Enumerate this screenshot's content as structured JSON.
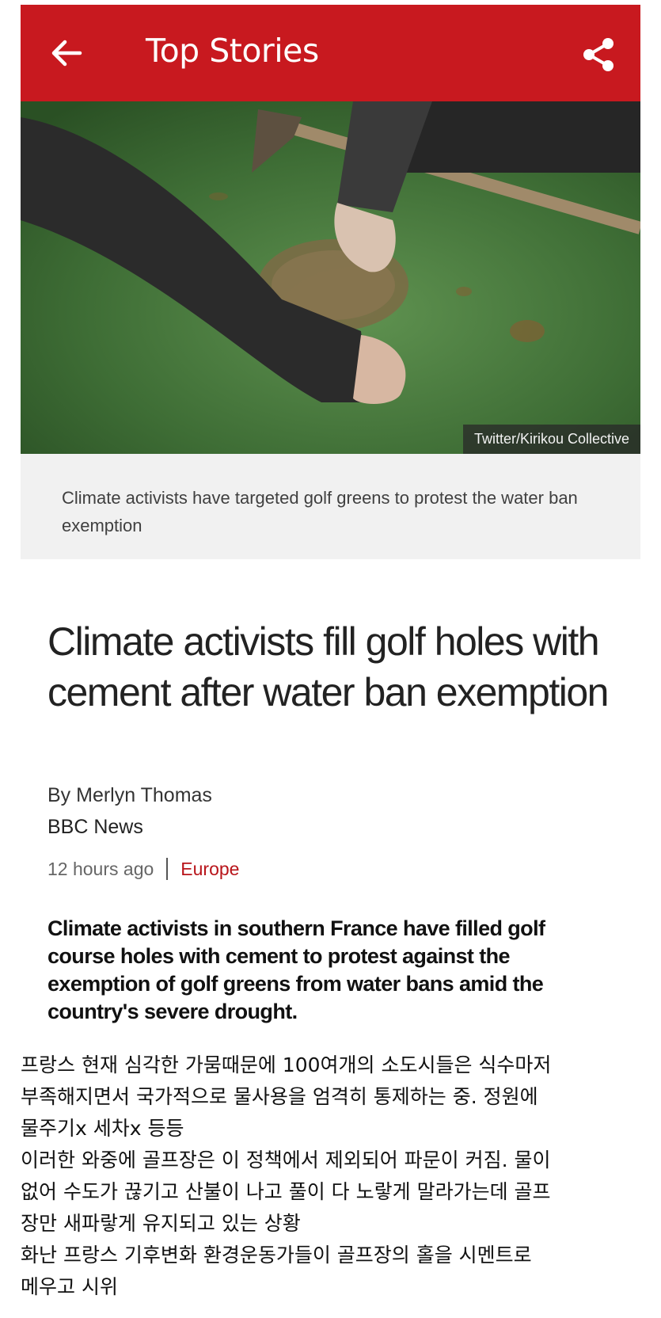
{
  "topbar": {
    "title": "Top Stories",
    "back_icon": "arrow-left-icon",
    "share_icon": "share-icon",
    "color": "#c8191f"
  },
  "hero": {
    "credit": "Twitter/Kirikou Collective",
    "caption": "Climate activists have targeted golf greens to protest the water ban exemption"
  },
  "article": {
    "headline": "Climate activists fill golf holes with cement after water ban exemption",
    "byline": "By Merlyn Thomas",
    "source": "BBC News",
    "time": "12 hours ago",
    "section": "Europe",
    "summary": "Climate activists in southern France have filled golf course holes with cement to protest against the exemption of golf greens from water bans amid the country's severe drought."
  },
  "comment": {
    "lines": [
      "프랑스 현재 심각한 가뭄때문에 100여개의 소도시들은 식수마저",
      "부족해지면서 국가적으로 물사용을 엄격히 통제하는 중. 정원에",
      "물주기x 세차x 등등",
      "이러한 와중에 골프장은 이 정책에서 제외되어 파문이 커짐. 물이",
      "없어 수도가 끊기고 산불이 나고 풀이 다 노랗게 말라가는데 골프",
      "장만 새파랗게 유지되고 있는 상황",
      "화난 프랑스 기후변화 환경운동가들이 골프장의 홀을 시멘트로",
      "메우고 시위"
    ]
  }
}
